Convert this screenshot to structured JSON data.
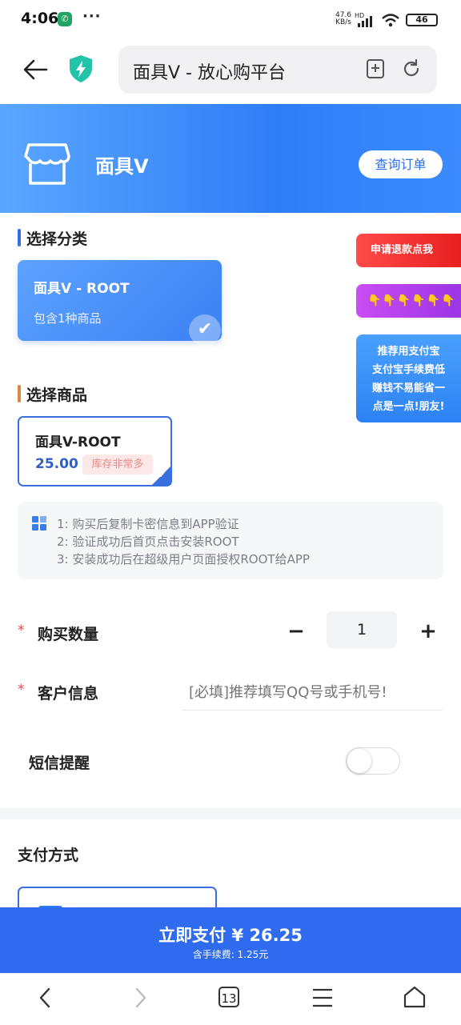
{
  "status_bar": {
    "time": "4:06",
    "dots": "···",
    "net_speed_value": "47.6",
    "net_speed_unit": "KB/s",
    "network_type": "HD",
    "battery": "46"
  },
  "browser": {
    "url_title": "面具V - 放心购平台",
    "icons": [
      "back-arrow-icon",
      "shield-bolt-icon",
      "add-bookmark-icon",
      "reload-icon"
    ]
  },
  "header": {
    "shop_name": "面具V",
    "query_button": "查询订单"
  },
  "category_section": {
    "title": "选择分类",
    "card_title": "面具V - ROOT",
    "card_subtitle": "包含1种商品"
  },
  "product_section": {
    "title": "选择商品",
    "product_name": "面具V-ROOT",
    "price": "25.00",
    "stock": "库存非常多"
  },
  "side_tabs": {
    "refund": "申请退款点我",
    "hands": "👇👇👇👇👇👇",
    "alipay_lines": [
      "推荐用支付宝",
      "支付宝手续费低",
      "赚钱不易能省一",
      "点是一点!朋友!"
    ]
  },
  "instructions": [
    "1: 购买后复制卡密信息到APP验证",
    "2: 验证成功后首页点击安装ROOT",
    "3: 安装成功后在超级用户页面授权ROOT给APP"
  ],
  "form": {
    "required_mark": "*",
    "quantity_label": "购买数量",
    "quantity_value": "1",
    "minus": "−",
    "plus": "+",
    "customer_label": "客户信息",
    "customer_placeholder": "[必填]推荐填写QQ号或手机号!",
    "sms_label": "短信提醒",
    "sms_enabled": false
  },
  "payment": {
    "title": "支付方式",
    "pay_button": "立即支付 ¥ 26.25",
    "fee_note": "含手续费: 1.25元"
  },
  "nav": {
    "tab_count": "13"
  },
  "colors": {
    "accent": "#2f6bef",
    "refund_red": "#e81f1f",
    "hand_purple": "#9b35e6",
    "stock_pink": "#fde8e8"
  }
}
